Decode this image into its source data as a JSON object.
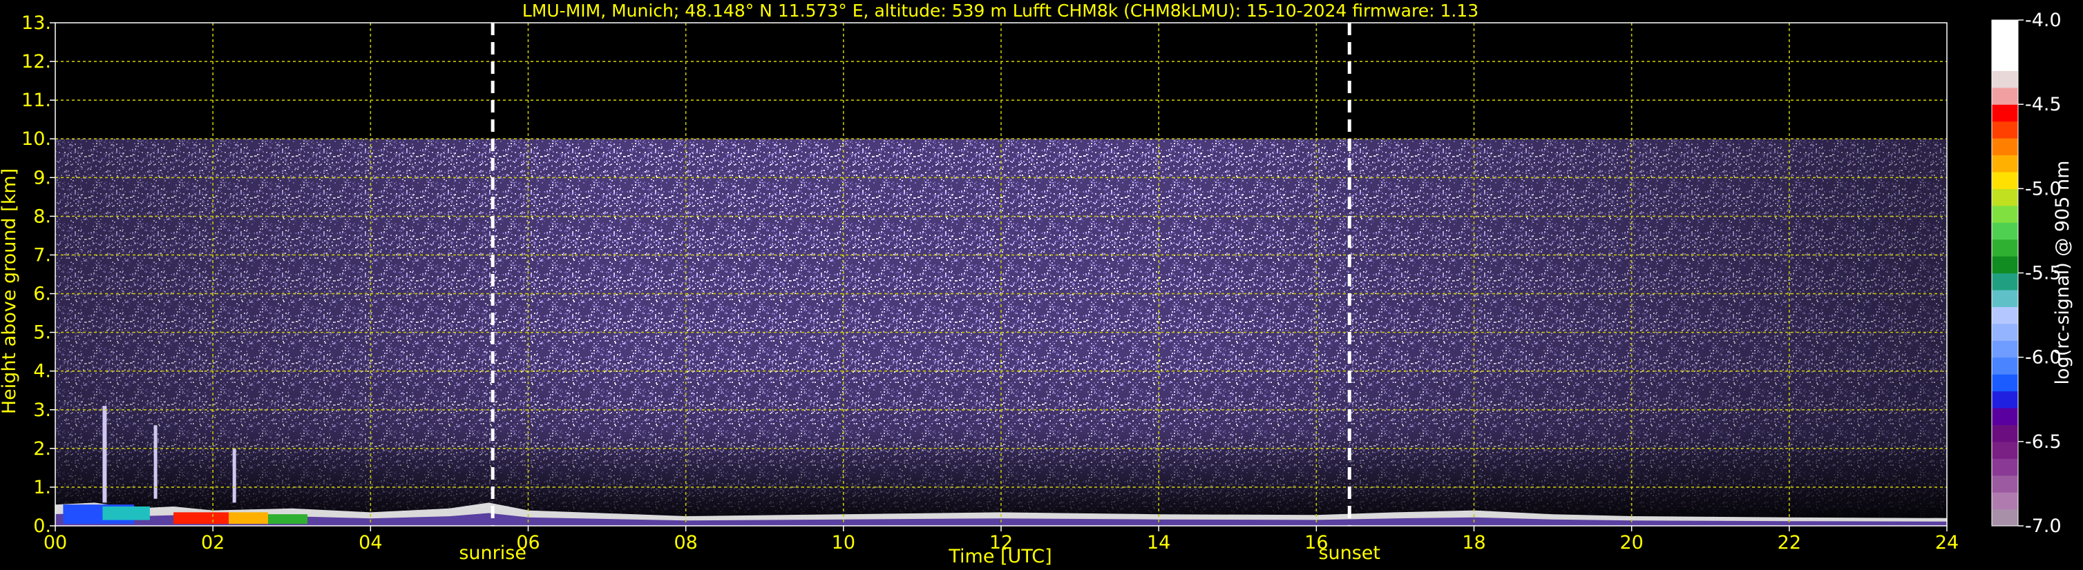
{
  "chart_data": {
    "type": "heatmap",
    "title": "LMU-MIM, Munich; 48.148° N 11.573° E, altitude: 539 m    Lufft CHM8k (CHM8kLMU): 15-10-2024    firmware: 1.13",
    "xlabel": "Time [UTC]",
    "ylabel": "Height above ground [km]",
    "xlim": [
      0,
      24
    ],
    "ylim": [
      0,
      13
    ],
    "x_ticks": [
      "00",
      "02",
      "04",
      "06",
      "08",
      "10",
      "12",
      "14",
      "16",
      "18",
      "20",
      "22",
      "24"
    ],
    "y_ticks": [
      "0.",
      "1.",
      "2.",
      "3.",
      "4.",
      "5.",
      "6.",
      "7.",
      "8.",
      "9.",
      "10.",
      "11.",
      "12.",
      "13."
    ],
    "grid": true,
    "markers": [
      {
        "label": "sunrise",
        "x": 5.55
      },
      {
        "label": "sunset",
        "x": 16.42
      }
    ],
    "signal_top_km": 10.0,
    "colorbar": {
      "label": "log(rc-signal) @ 905 nm",
      "range": [
        -7.0,
        -4.0
      ],
      "ticks": [
        "-4.0",
        "-4.5",
        "-5.0",
        "-5.5",
        "-6.0",
        "-6.5",
        "-7.0"
      ],
      "colors": [
        "#a890a8",
        "#b07cb0",
        "#9c5aa0",
        "#8a3a94",
        "#7a1f84",
        "#6a0e80",
        "#5a00a0",
        "#2020e0",
        "#1a5cff",
        "#4a84ff",
        "#6e9cff",
        "#94b4ff",
        "#b4c8ff",
        "#60c0c8",
        "#20a080",
        "#108c20",
        "#30b030",
        "#50d050",
        "#80e040",
        "#c0e020",
        "#ffe000",
        "#ffb000",
        "#ff8000",
        "#ff4000",
        "#ff0000",
        "#f0a0a0",
        "#e8d8d8",
        "#ffffff",
        "#ffffff",
        "#ffffff"
      ]
    }
  },
  "colors": {
    "text": "#ffff00",
    "grid": "#c8c800",
    "marker": "#ffffff",
    "colorbar_text": "#ffffff"
  }
}
